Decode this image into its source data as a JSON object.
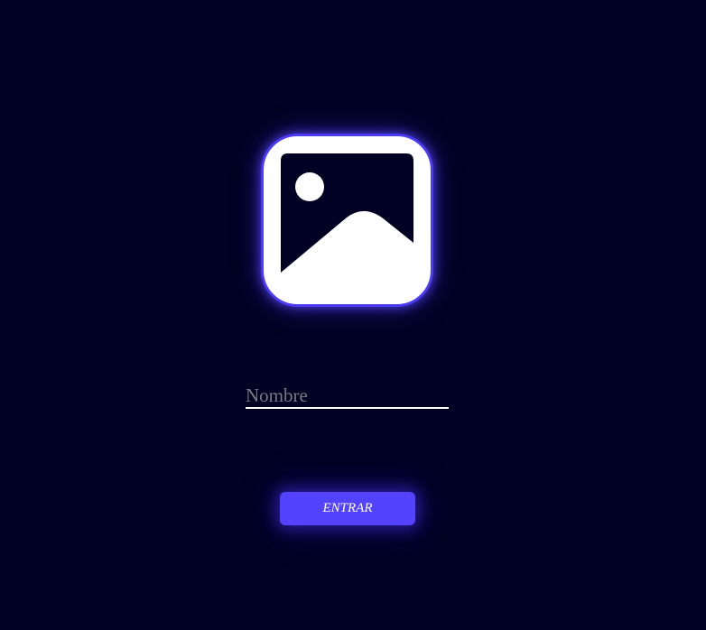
{
  "logo": {
    "icon": "image-icon",
    "tile_color": "#ffffff",
    "border_color": "#4b3bf5",
    "glow_color": "#5a46ff",
    "inner_color": "#010123"
  },
  "form": {
    "name_placeholder": "Nombre",
    "name_value": ""
  },
  "button": {
    "label": "ENTRAR",
    "color": "#5343ff"
  },
  "theme": {
    "background": "#010123"
  }
}
